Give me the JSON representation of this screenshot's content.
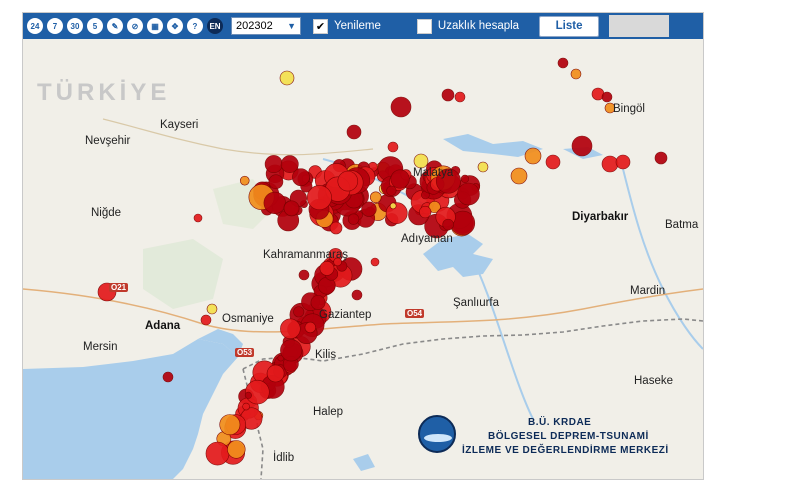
{
  "toolbar": {
    "buttons": [
      "24",
      "7",
      "30",
      "5",
      "",
      "",
      "",
      "",
      "?",
      "EN"
    ],
    "period_value": "202302",
    "refresh_label": "Yenileme",
    "refresh_checked": true,
    "distance_label": "Uzaklık hesapla",
    "distance_checked": false,
    "list_label": "Liste"
  },
  "map": {
    "country_label": "TÜRKİYE",
    "places": {
      "kayseri": "Kayseri",
      "nevsehir": "Nevşehir",
      "nigde": "Niğde",
      "adana": "Adana",
      "mersin": "Mersin",
      "osmaniye": "Osmaniye",
      "kahramanmaras": "Kahramanmaraş",
      "adiyaman": "Adıyaman",
      "malatya": "Malatya",
      "gaziantep": "Gaziantep",
      "sanliurfa": "Şanlıurfa",
      "kilis": "Kilis",
      "halep": "Halep",
      "idlib": "İdlib",
      "diyarbakir": "Diyarbakır",
      "batman": "Batma",
      "mardin": "Mardin",
      "haseke": "Haseke",
      "bingol": "Bingöl"
    },
    "roads": {
      "o21": "O21",
      "o53": "O53",
      "o54": "O54"
    }
  },
  "logo": {
    "line1": "B.Ü. KRDAE",
    "line2": "BÖLGESEL DEPREM-TSUNAMİ",
    "line3": "İZLEME VE DEĞERLENDİRME MERKEZİ"
  },
  "colors": {
    "toolbar": "#1f5fa6",
    "land": "#f1efe8",
    "sea": "#a9cdeb",
    "lake": "#a9cdeb",
    "border": "#8a8a8a",
    "quake_dark_red": "#b3000c",
    "quake_red": "#e31a1c",
    "quake_orange": "#f28e1c",
    "quake_yellow": "#f4e04d"
  }
}
